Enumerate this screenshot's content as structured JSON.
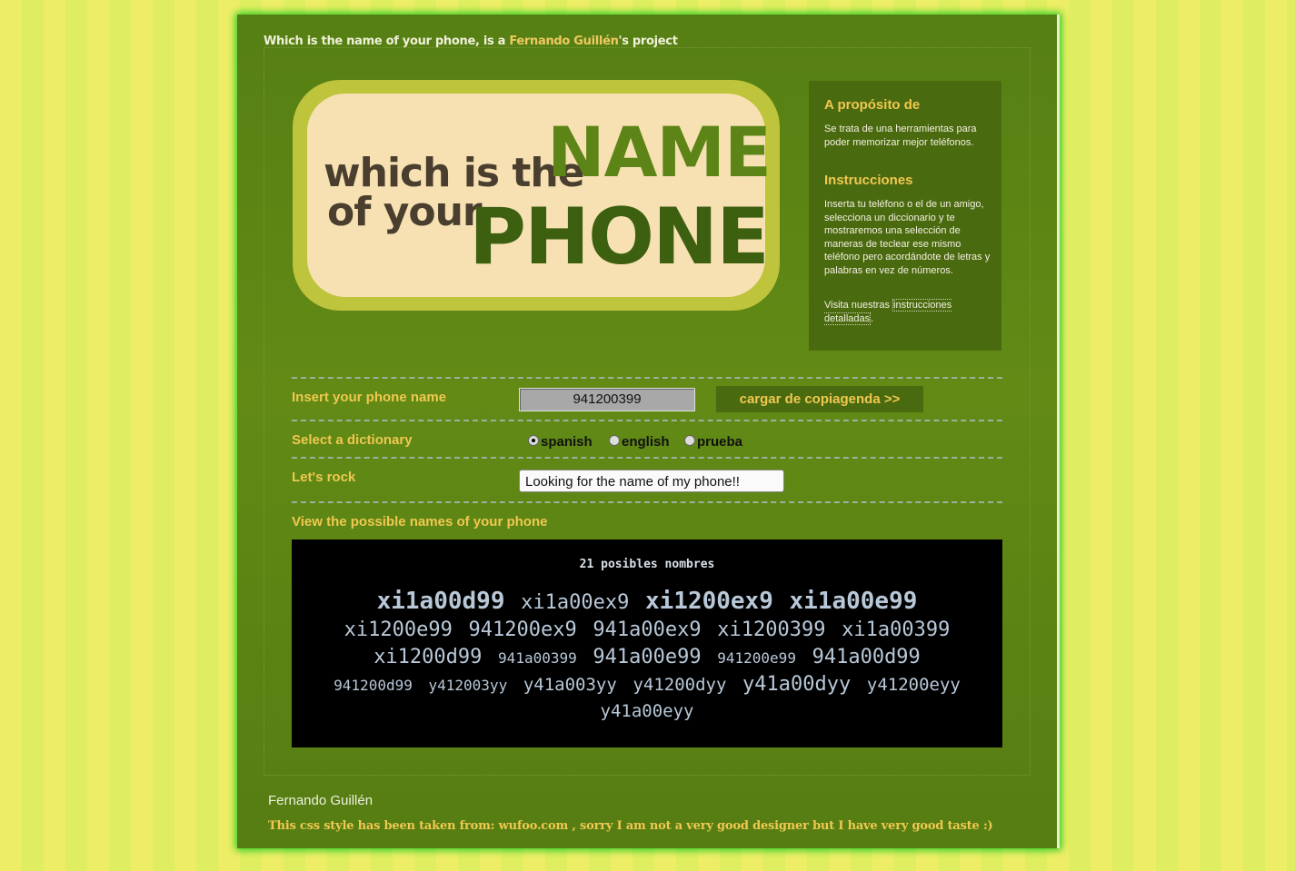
{
  "header": {
    "intro_text": "Which is the name of your phone, is a ",
    "author_link": "Fernando Guillén",
    "intro_suffix": "'s project"
  },
  "logo": {
    "line1": "which is the",
    "line2": "of your",
    "name_word": "NAME",
    "phone_word": "PHONE"
  },
  "sidebar": {
    "about_title": "A propósito de",
    "about_text": "Se trata de una herramientas para poder memorizar mejor teléfonos.",
    "instructions_title": "Instrucciones",
    "instructions_text": "Inserta tu teléfono o el de un amigo, selecciona un diccionario y te mostraremos una selección de maneras de teclear ese mismo teléfono pero acordándote de letras y palabras en vez de números.",
    "visit_prefix": "Visita nuestras ",
    "visit_link": "instrucciones detalladas",
    "visit_suffix": "."
  },
  "form": {
    "phone_label": "Insert your phone name",
    "phone_value": "941200399",
    "load_button": "cargar de copiagenda >>",
    "dict_label": "Select a dictionary",
    "dictionaries": [
      "spanish",
      "english",
      "prueba"
    ],
    "selected_dictionary": "spanish",
    "rock_label": "Let's rock",
    "rock_button": "Looking for the name of my phone!!",
    "results_label": "View the possible names of your phone"
  },
  "results": {
    "count_text": "21 posibles nombres",
    "names": [
      {
        "text": "xi1a00d99",
        "size": 4
      },
      {
        "text": "xi1a00ex9",
        "size": 3
      },
      {
        "text": "xi1200ex9",
        "size": 4
      },
      {
        "text": "xi1a00e99",
        "size": 4
      },
      {
        "text": "xi1200e99",
        "size": 3
      },
      {
        "text": "941200ex9",
        "size": 3
      },
      {
        "text": "941a00ex9",
        "size": 3
      },
      {
        "text": "xi1200399",
        "size": 3
      },
      {
        "text": "xi1a00399",
        "size": 3
      },
      {
        "text": "xi1200d99",
        "size": 3
      },
      {
        "text": "941a00399",
        "size": 1
      },
      {
        "text": "941a00e99",
        "size": 3
      },
      {
        "text": "941200e99",
        "size": 1
      },
      {
        "text": "941a00d99",
        "size": 3
      },
      {
        "text": "941200d99",
        "size": 1
      },
      {
        "text": "y412003yy",
        "size": 1
      },
      {
        "text": "y41a003yy",
        "size": 2
      },
      {
        "text": "y41200dyy",
        "size": 2
      },
      {
        "text": "y41a00dyy",
        "size": 3
      },
      {
        "text": "y41200eyy",
        "size": 2
      },
      {
        "text": "y41a00eyy",
        "size": 2
      }
    ]
  },
  "footer": {
    "name": "Fernando Guillén",
    "note": "This css style has been taken from: wufoo.com , sorry I am not a very good designer but I have very good taste :)"
  },
  "colors": {
    "accent": "#f0c850",
    "panel": "#4a6a10",
    "glow": "#22cc22"
  }
}
